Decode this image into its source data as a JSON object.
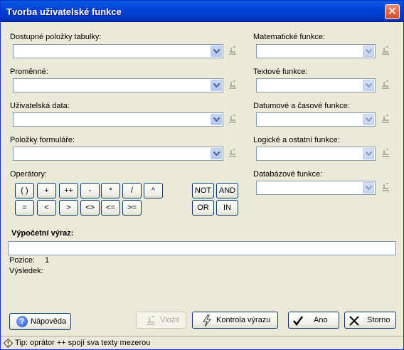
{
  "window": {
    "title": "Tvorba uživatelské funkce",
    "close_label": "✕"
  },
  "left_fields": [
    {
      "label": "Dostupné položky tabulky:"
    },
    {
      "label": "Proměnné:"
    },
    {
      "label": "Uživatelská data:"
    },
    {
      "label": "Položky formuláře:"
    }
  ],
  "right_fields": [
    {
      "label": "Matematické funkce:"
    },
    {
      "label": "Textové funkce:"
    },
    {
      "label": "Datumové a časové funkce:"
    },
    {
      "label": "Logické a ostatní funkce:"
    },
    {
      "label": "Databázové funkce:"
    }
  ],
  "operators": {
    "label": "Operátory:",
    "row1": [
      "( )",
      "+",
      "++",
      "-",
      "*",
      "/",
      "^"
    ],
    "row2": [
      "=",
      "<",
      ">",
      "<>",
      "<=",
      ">="
    ],
    "logical": [
      "NOT",
      "AND",
      "OR",
      "IN"
    ]
  },
  "expression": {
    "label": "Výpočetní výraz:",
    "value": "",
    "position_label": "Pozice:",
    "position_value": "1",
    "result_label": "Výsledek:"
  },
  "buttons": {
    "help": "Nápověda",
    "insert": "Vložit",
    "check": "Kontrola výrazu",
    "ok": "Ano",
    "cancel": "Storno"
  },
  "status": {
    "tip": "Tip: oprátor ++ spojí sva texty mezerou"
  },
  "icons": [
    "insert-icon",
    "help-icon",
    "check-icon",
    "ok-check-icon",
    "cancel-x-icon",
    "tip-icon",
    "chevron-down-icon"
  ]
}
